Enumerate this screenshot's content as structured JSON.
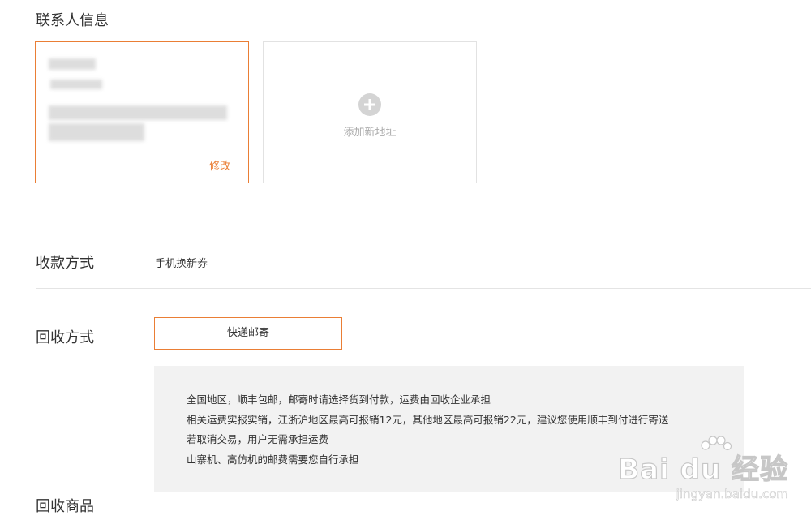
{
  "contact": {
    "title": "联系人信息",
    "selected_card": {
      "edit_label": "修改"
    },
    "add_card": {
      "label": "添加新地址",
      "icon": "plus-circle-icon"
    }
  },
  "payment": {
    "title": "收款方式",
    "value": "手机换新券"
  },
  "recycle_method": {
    "title": "回收方式",
    "option_label": "快递邮寄",
    "info_lines": [
      "全国地区，顺丰包邮，邮寄时请选择货到付款，运费由回收企业承担",
      "相关运费实报实销，江浙沪地区最高可报销12元，其他地区最高可报销22元，建议您使用顺丰到付进行寄送",
      "若取消交易，用户无需承担运费",
      "山寨机、高仿机的邮费需要您自行承担"
    ]
  },
  "recycle_goods": {
    "title": "回收商品"
  },
  "watermark": {
    "main": "Bai du 经验",
    "sub": "jingyan.baidu.com"
  },
  "colors": {
    "accent": "#ea7e35",
    "info_bg": "#f2f2f2",
    "border": "#e2e2e2"
  }
}
